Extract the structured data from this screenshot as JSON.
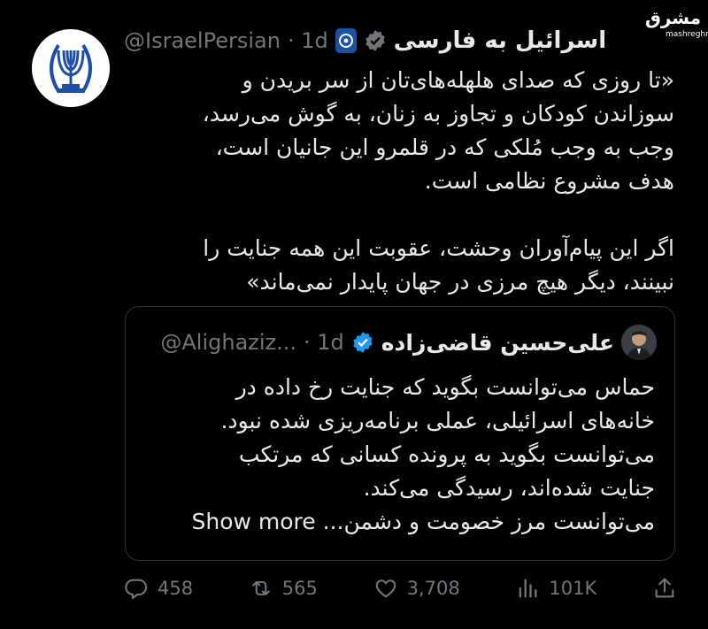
{
  "watermark": {
    "arabic": "مشرق",
    "latin": "mashreghnews.ir"
  },
  "tweet": {
    "author_name": "اسرائیل به فارسی",
    "handle": "@IsraelPersian",
    "time": "· 1d",
    "lines": [
      "«تا روزی که صدای هلهله‌های‌تان از سر بریدن و",
      "سوزاندن کودکان و تجاوز به زنان، به گوش می‌رسد،",
      "وجب به وجب مُلکی که در قلمرو این جانیان است،",
      "هدف مشروع نظامی است.",
      "اگر این پیام‌آوران وحشت، عقوبت این همه جنایت را",
      "نبینند، دیگر هیچ مرزی در جهان پایدار نمی‌ماند»"
    ]
  },
  "quote": {
    "author_name": "علی‌حسین قاضی‌زاده",
    "handle": "@Alighaziz...",
    "time": "· 1d",
    "lines": [
      "حماس می‌توانست بگوید که جنایت رخ داده در",
      "خانه‌های اسرائیلی، عملی برنامه‌ریزی شده نبود.",
      "می‌توانست بگوید به پرونده کسانی که مرتکب",
      "جنایت شده‌اند، رسیدگی می‌کند.",
      "می‌توانست مرز خصومت و دشمن..."
    ],
    "show_more": "Show more"
  },
  "actions": {
    "replies": "458",
    "retweets": "565",
    "likes": "3,708",
    "views": "101K"
  },
  "colors": {
    "verified": "#1d9bf0",
    "muted": "#71767b",
    "text": "#e7e9ea",
    "border": "#2f3336"
  }
}
